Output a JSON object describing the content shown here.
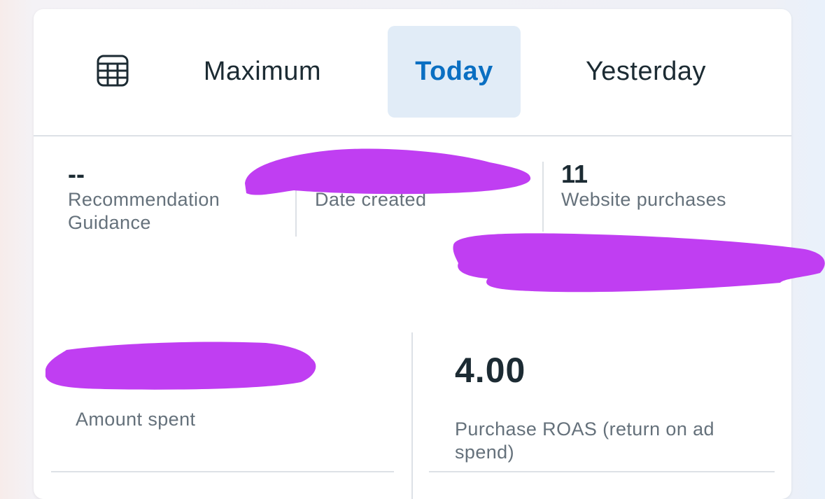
{
  "colors": {
    "accent": "#0a6fc2",
    "selected_tab_bg": "#e1ecf7",
    "text_primary": "#1c2b33",
    "text_secondary": "#65717b",
    "redaction": "#c03ef2"
  },
  "date_tabs": {
    "calendar_icon": "calendar-grid-icon",
    "items": [
      {
        "label": "Maximum",
        "selected": false
      },
      {
        "label": "Today",
        "selected": true
      },
      {
        "label": "Yesterday",
        "selected": false
      }
    ]
  },
  "metrics": {
    "recommendation": {
      "value": "--",
      "label": "Recommendation Guidance"
    },
    "date_created": {
      "value": "",
      "label": "Date created"
    },
    "website_purchases": {
      "value": "11",
      "label": "Website purchases"
    },
    "amount_spent": {
      "value": "",
      "label": "Amount spent"
    },
    "purchase_roas": {
      "value": "4.00",
      "label": "Purchase ROAS (return on ad spend)"
    }
  }
}
